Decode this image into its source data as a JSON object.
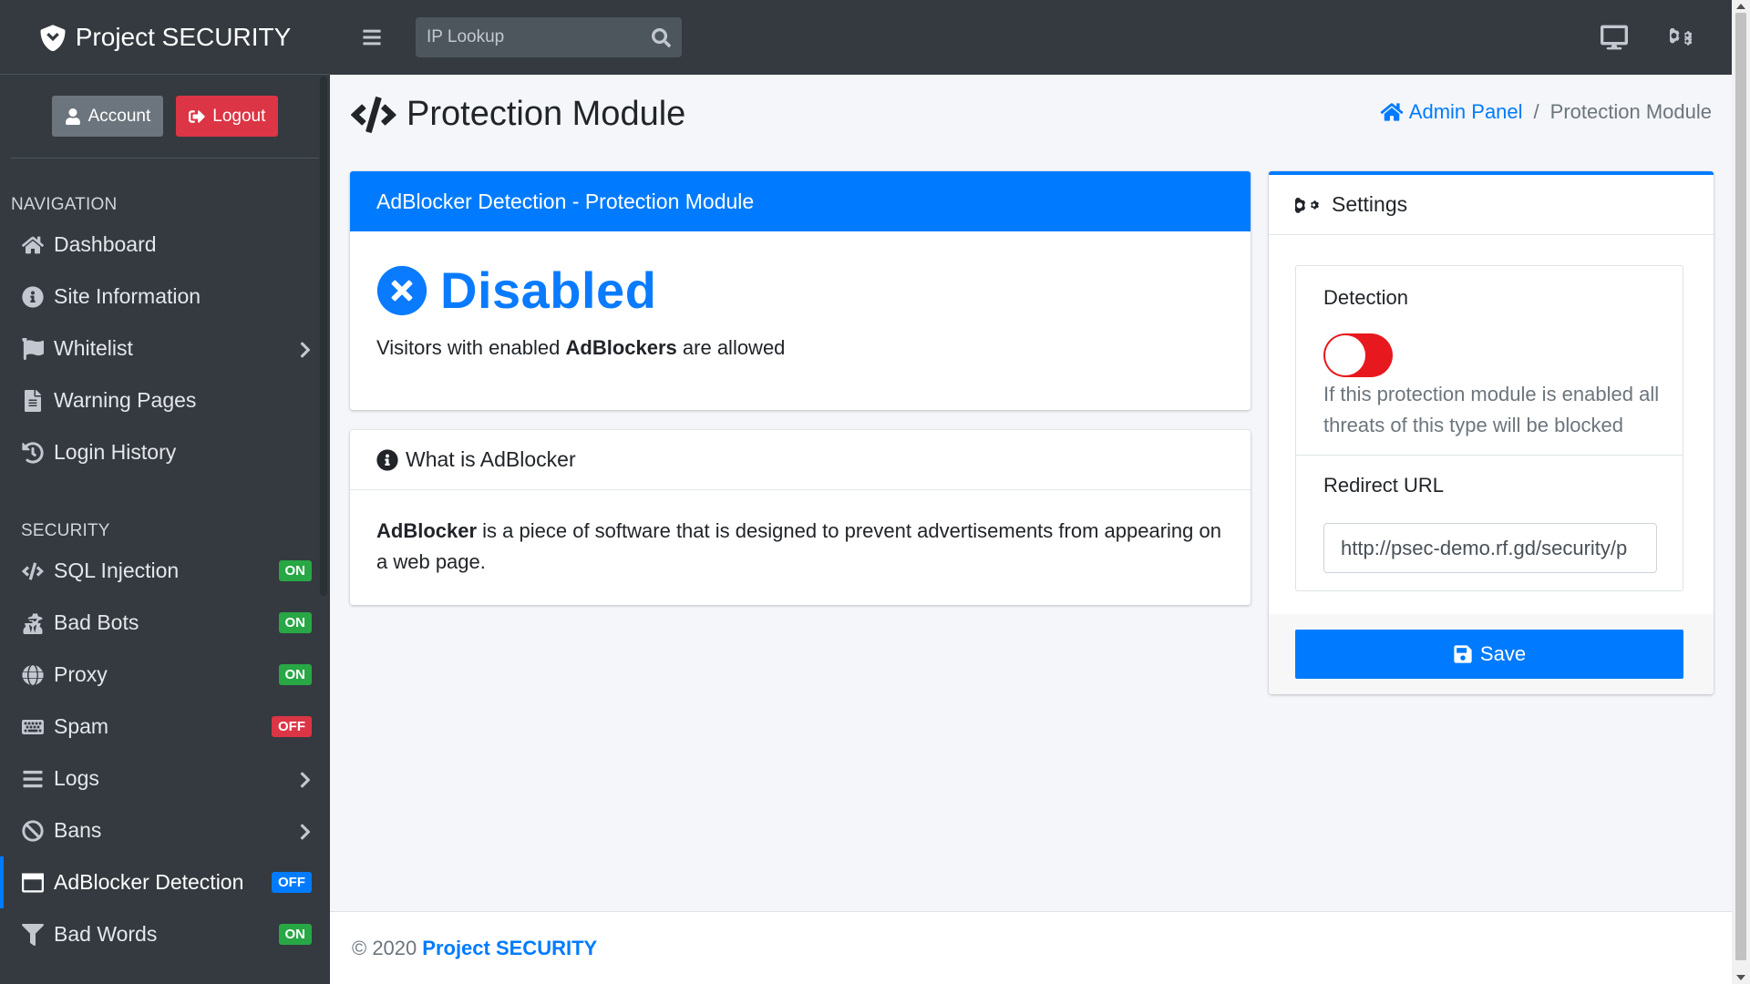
{
  "brand": {
    "title": "Project SECURITY",
    "icon": "shield-icon"
  },
  "user_panel": {
    "account_label": "Account",
    "logout_label": "Logout"
  },
  "sidebar": {
    "nav_header": "NAVIGATION",
    "nav_items": [
      {
        "label": "Dashboard",
        "icon": "home-icon"
      },
      {
        "label": "Site Information",
        "icon": "info-circle-icon"
      },
      {
        "label": "Whitelist",
        "icon": "flag-icon",
        "has_children": true
      },
      {
        "label": "Warning Pages",
        "icon": "file-icon"
      },
      {
        "label": "Login History",
        "icon": "history-icon"
      }
    ],
    "security_header": "SECURITY",
    "security_items": [
      {
        "label": "SQL Injection",
        "icon": "code-icon",
        "badge": "ON"
      },
      {
        "label": "Bad Bots",
        "icon": "user-secret-icon",
        "badge": "ON"
      },
      {
        "label": "Proxy",
        "icon": "globe-icon",
        "badge": "ON"
      },
      {
        "label": "Spam",
        "icon": "keyboard-icon",
        "badge": "OFF"
      },
      {
        "label": "Logs",
        "icon": "list-icon",
        "has_children": true
      },
      {
        "label": "Bans",
        "icon": "ban-icon",
        "has_children": true
      },
      {
        "label": "AdBlocker Detection",
        "icon": "window-icon",
        "badge": "OFF",
        "active": true
      },
      {
        "label": "Bad Words",
        "icon": "filter-icon",
        "badge": "ON"
      }
    ]
  },
  "topbar": {
    "search_placeholder": "IP Lookup"
  },
  "page": {
    "title": "Protection Module",
    "breadcrumb": {
      "home": "Admin Panel",
      "current": "Protection Module"
    }
  },
  "status_card": {
    "header": "AdBlocker Detection - Protection Module",
    "status": "Disabled",
    "desc_prefix": "Visitors with enabled",
    "desc_bold": "AdBlockers",
    "desc_suffix": "are allowed"
  },
  "what_card": {
    "header": "What is AdBlocker",
    "body_bold": "AdBlocker",
    "body_text": "is a piece of software that is designed to prevent advertisements from appearing on a web page."
  },
  "settings_card": {
    "header": "Settings",
    "detection_label": "Detection",
    "detection_enabled": false,
    "help_text": "If this protection module is enabled all threats of this type will be blocked",
    "redirect_label": "Redirect URL",
    "redirect_value": "http://psec-demo.rf.gd/security/p",
    "save_label": "Save"
  },
  "footer": {
    "copyright": "© 2020",
    "brand": "Project SECURITY"
  },
  "colors": {
    "primary": "#007bff",
    "danger": "#dc3545",
    "success": "#28a745",
    "sidebar_bg": "#343a40"
  }
}
